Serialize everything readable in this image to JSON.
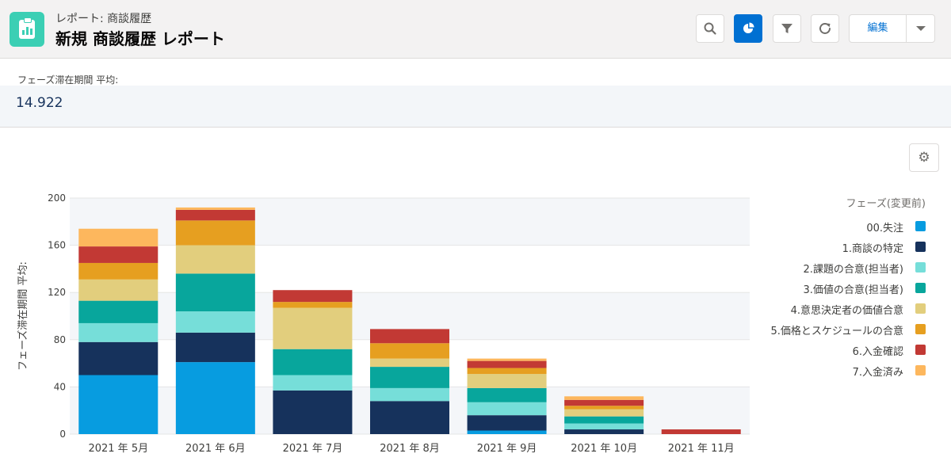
{
  "header": {
    "subtitle": "レポート: 商談履歴",
    "title": "新規 商談履歴 レポート",
    "edit_label": "編集",
    "icons": [
      "search-icon",
      "chart-icon",
      "filter-icon",
      "refresh-icon",
      "chevron-down-icon"
    ]
  },
  "metric": {
    "label": "フェーズ滞在期間 平均:",
    "value": "14.922"
  },
  "colors": {
    "accent": "#0070d2",
    "app_icon": "#3bcfb4"
  },
  "chart_data": {
    "type": "bar",
    "stacked": true,
    "categories": [
      "2021 年 5月",
      "2021 年 6月",
      "2021 年 7月",
      "2021 年 8月",
      "2021 年 9月",
      "2021 年 10月",
      "2021 年 11月"
    ],
    "ylabel": "フェーズ滞在期間 平均:",
    "ylim": [
      0,
      200
    ],
    "yticks": [
      0,
      40,
      80,
      120,
      160,
      200
    ],
    "grid": true,
    "legend_title": "フェーズ(変更前)",
    "legend_position": "right",
    "series": [
      {
        "name": "00.失注",
        "color": "#079ce0",
        "values": [
          50,
          61,
          0,
          0,
          3,
          0,
          0
        ]
      },
      {
        "name": "1.商談の特定",
        "color": "#16325c",
        "values": [
          28,
          25,
          37,
          28,
          13,
          4,
          0
        ]
      },
      {
        "name": "2.課題の合意(担当者)",
        "color": "#76ded9",
        "values": [
          16,
          18,
          13,
          11,
          11,
          5,
          0
        ]
      },
      {
        "name": "3.価値の合意(担当者)",
        "color": "#08a69c",
        "values": [
          19,
          32,
          22,
          18,
          12,
          6,
          0
        ]
      },
      {
        "name": "4.意思決定者の価値合意",
        "color": "#e2ce7d",
        "values": [
          18,
          24,
          35,
          7,
          12,
          6,
          0
        ]
      },
      {
        "name": "5.価格とスケジュールの合意",
        "color": "#e69f20",
        "values": [
          14,
          21,
          5,
          13,
          5,
          3,
          0
        ]
      },
      {
        "name": "6.入金確認",
        "color": "#c23934",
        "values": [
          14,
          9,
          10,
          12,
          6,
          5,
          4
        ]
      },
      {
        "name": "7.入金済み",
        "color": "#fdb75d",
        "values": [
          15,
          2,
          0,
          0,
          2,
          3,
          0
        ]
      }
    ]
  }
}
